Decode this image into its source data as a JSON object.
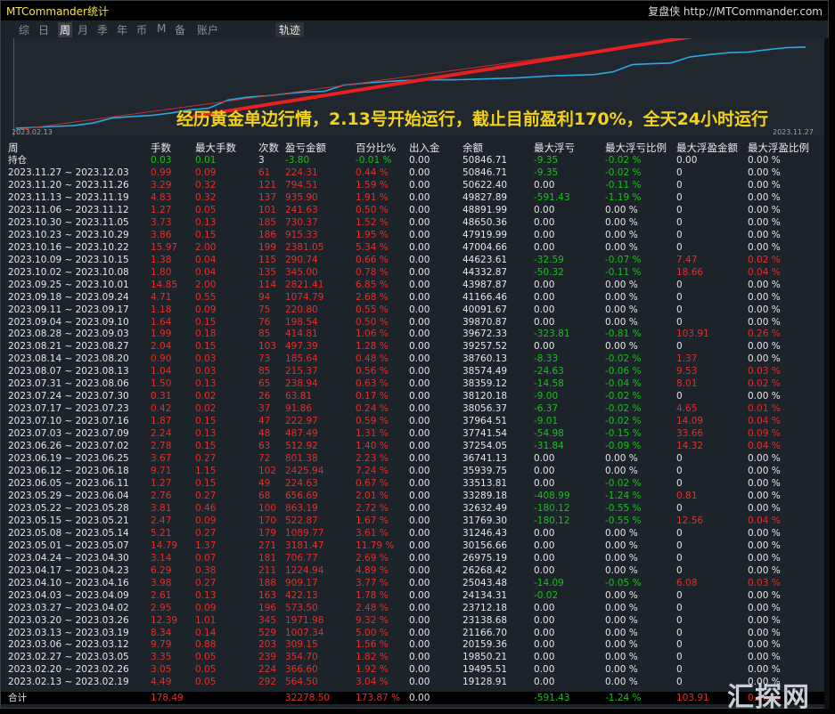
{
  "window": {
    "title": "MTCommander统计",
    "brand": "复盘侠",
    "url": "http://MTCommander.com"
  },
  "tabs": [
    {
      "label": "综",
      "active": false
    },
    {
      "label": "日",
      "active": false
    },
    {
      "label": "周",
      "active": true
    },
    {
      "label": "月",
      "active": false
    },
    {
      "label": "季",
      "active": false
    },
    {
      "label": "年",
      "active": false
    },
    {
      "label": "币",
      "active": false
    },
    {
      "label": "M",
      "active": false
    },
    {
      "label": "备",
      "active": false
    },
    {
      "label": "账户",
      "active": false
    },
    {
      "label": "轨迹",
      "active": false
    }
  ],
  "chart": {
    "annotation": "经历黄金单边行情，2.13号开始运行，截止目前盈利170%，全天24小时运行",
    "x_start": "2023.02.13",
    "x_end": "2023.11.27",
    "colors": {
      "equity": "#2aa8e0",
      "arrow": "#e82020",
      "trend": "#c23030"
    }
  },
  "columns": [
    "周",
    "手数",
    "最大手数",
    "次数",
    "盈亏金额",
    "百分比%",
    "出入金",
    "余额",
    "最大浮亏",
    "最大浮亏比例",
    "最大浮盈金额",
    "最大浮盈比例"
  ],
  "holding": [
    "持仓",
    "0.03",
    "0.01",
    "3",
    "-3.80",
    "-0.01 %",
    "0.00",
    "50846.71",
    "-9.35",
    "-0.02 %",
    "0.00",
    "0.00 %"
  ],
  "rows": [
    [
      "2023.11.27 ~ 2023.12.03",
      "0.99",
      "0.09",
      "61",
      "224.31",
      "0.44 %",
      "0.00",
      "50846.71",
      "-9.35",
      "-0.02 %",
      "0",
      "0.00 %"
    ],
    [
      "2023.11.20 ~ 2023.11.26",
      "3.29",
      "0.32",
      "121",
      "794.51",
      "1.59 %",
      "0.00",
      "50622.40",
      "0.00",
      "-0.11 %",
      "0",
      "0.00 %"
    ],
    [
      "2023.11.13 ~ 2023.11.19",
      "4.83",
      "0.32",
      "137",
      "935.90",
      "1.91 %",
      "0.00",
      "49827.89",
      "-591.43",
      "-1.19 %",
      "0",
      "0.00 %"
    ],
    [
      "2023.11.06 ~ 2023.11.12",
      "1.27",
      "0.05",
      "101",
      "241.63",
      "0.50 %",
      "0.00",
      "48891.99",
      "0.00",
      "0.00 %",
      "0",
      "0.00 %"
    ],
    [
      "2023.10.30 ~ 2023.11.05",
      "3.73",
      "0.13",
      "185",
      "730.37",
      "1.52 %",
      "0.00",
      "48650.36",
      "0.00",
      "0.00 %",
      "0",
      "0.00 %"
    ],
    [
      "2023.10.23 ~ 2023.10.29",
      "3.86",
      "0.15",
      "186",
      "915.33",
      "1.95 %",
      "0.00",
      "47919.99",
      "0.00",
      "0.00 %",
      "0",
      "0.00 %"
    ],
    [
      "2023.10.16 ~ 2023.10.22",
      "15.97",
      "2.00",
      "199",
      "2381.05",
      "5.34 %",
      "0.00",
      "47004.66",
      "0.00",
      "0.00 %",
      "0",
      "0.00 %"
    ],
    [
      "2023.10.09 ~ 2023.10.15",
      "1.38",
      "0.04",
      "115",
      "290.74",
      "0.66 %",
      "0.00",
      "44623.61",
      "-32.59",
      "-0.07 %",
      "7.47",
      "0.02 %"
    ],
    [
      "2023.10.02 ~ 2023.10.08",
      "1.80",
      "0.04",
      "135",
      "345.00",
      "0.78 %",
      "0.00",
      "44332.87",
      "-50.32",
      "-0.11 %",
      "18.66",
      "0.04 %"
    ],
    [
      "2023.09.25 ~ 2023.10.01",
      "14.85",
      "2.00",
      "114",
      "2821.41",
      "6.85 %",
      "0.00",
      "43987.87",
      "0.00",
      "0.00 %",
      "0",
      "0.00 %"
    ],
    [
      "2023.09.18 ~ 2023.09.24",
      "4.71",
      "0.55",
      "94",
      "1074.79",
      "2.68 %",
      "0.00",
      "41166.46",
      "0.00",
      "0.00 %",
      "0",
      "0.00 %"
    ],
    [
      "2023.09.11 ~ 2023.09.17",
      "1.18",
      "0.09",
      "75",
      "220.80",
      "0.55 %",
      "0.00",
      "40091.67",
      "0.00",
      "0.00 %",
      "0",
      "0.00 %"
    ],
    [
      "2023.09.04 ~ 2023.09.10",
      "1.64",
      "0.15",
      "76",
      "198.54",
      "0.50 %",
      "0.00",
      "39870.87",
      "0.00",
      "0.00 %",
      "0",
      "0.00 %"
    ],
    [
      "2023.08.28 ~ 2023.09.03",
      "1.99",
      "0.18",
      "85",
      "414.81",
      "1.06 %",
      "0.00",
      "39672.33",
      "-323.81",
      "-0.81 %",
      "103.91",
      "0.26 %"
    ],
    [
      "2023.08.21 ~ 2023.08.27",
      "2.04",
      "0.15",
      "103",
      "497.39",
      "1.28 %",
      "0.00",
      "39257.52",
      "0.00",
      "0.00 %",
      "0",
      "0.00 %"
    ],
    [
      "2023.08.14 ~ 2023.08.20",
      "0.90",
      "0.03",
      "73",
      "185.64",
      "0.48 %",
      "0.00",
      "38760.13",
      "-8.33",
      "-0.02 %",
      "1.37",
      "0.00 %"
    ],
    [
      "2023.08.07 ~ 2023.08.13",
      "1.04",
      "0.03",
      "85",
      "215.37",
      "0.56 %",
      "0.00",
      "38574.49",
      "-24.63",
      "-0.06 %",
      "9.53",
      "0.03 %"
    ],
    [
      "2023.07.31 ~ 2023.08.06",
      "1.50",
      "0.13",
      "65",
      "238.94",
      "0.63 %",
      "0.00",
      "38359.12",
      "-14.58",
      "-0.04 %",
      "8.01",
      "0.02 %"
    ],
    [
      "2023.07.24 ~ 2023.07.30",
      "0.31",
      "0.02",
      "26",
      "63.81",
      "0.17 %",
      "0.00",
      "38120.18",
      "-9.00",
      "-0.02 %",
      "0",
      "0.00 %"
    ],
    [
      "2023.07.17 ~ 2023.07.23",
      "0.42",
      "0.02",
      "37",
      "91.86",
      "0.24 %",
      "0.00",
      "38056.37",
      "-6.37",
      "-0.02 %",
      "4.65",
      "0.01 %"
    ],
    [
      "2023.07.10 ~ 2023.07.16",
      "1.87",
      "0.15",
      "47",
      "222.97",
      "0.59 %",
      "0.00",
      "37964.51",
      "-9.01",
      "-0.02 %",
      "14.09",
      "0.04 %"
    ],
    [
      "2023.07.03 ~ 2023.07.09",
      "2.24",
      "0.13",
      "48",
      "487.49",
      "1.31 %",
      "0.00",
      "37741.54",
      "-54.98",
      "-0.15 %",
      "33.66",
      "0.09 %"
    ],
    [
      "2023.06.26 ~ 2023.07.02",
      "2.78",
      "0.15",
      "63",
      "512.92",
      "1.40 %",
      "0.00",
      "37254.05",
      "-31.84",
      "-0.09 %",
      "14.32",
      "0.04 %"
    ],
    [
      "2023.06.19 ~ 2023.06.25",
      "3.67",
      "0.27",
      "72",
      "801.38",
      "2.23 %",
      "0.00",
      "36741.13",
      "0.00",
      "0.00 %",
      "0",
      "0.00 %"
    ],
    [
      "2023.06.12 ~ 2023.06.18",
      "9.71",
      "1.15",
      "102",
      "2425.94",
      "7.24 %",
      "0.00",
      "35939.75",
      "0.00",
      "0.00 %",
      "0",
      "0.00 %"
    ],
    [
      "2023.06.05 ~ 2023.06.11",
      "1.27",
      "0.15",
      "49",
      "224.63",
      "0.67 %",
      "0.00",
      "33513.81",
      "0.00",
      "-0.02 %",
      "0",
      "0.00 %"
    ],
    [
      "2023.05.29 ~ 2023.06.04",
      "2.76",
      "0.27",
      "68",
      "656.69",
      "2.01 %",
      "0.00",
      "33289.18",
      "-408.99",
      "-1.24 %",
      "0.81",
      "0.00 %"
    ],
    [
      "2023.05.22 ~ 2023.05.28",
      "3.81",
      "0.46",
      "100",
      "863.19",
      "2.72 %",
      "0.00",
      "32632.49",
      "-180.12",
      "-0.55 %",
      "0",
      "0.00 %"
    ],
    [
      "2023.05.15 ~ 2023.05.21",
      "2.47",
      "0.09",
      "170",
      "522.87",
      "1.67 %",
      "0.00",
      "31769.30",
      "-180.12",
      "-0.55 %",
      "12.56",
      "0.04 %"
    ],
    [
      "2023.05.08 ~ 2023.05.14",
      "5.21",
      "0.27",
      "179",
      "1089.77",
      "3.61 %",
      "0.00",
      "31246.43",
      "0.00",
      "0.00 %",
      "0",
      "0.00 %"
    ],
    [
      "2023.05.01 ~ 2023.05.07",
      "14.79",
      "1.37",
      "271",
      "3181.47",
      "11.79 %",
      "0.00",
      "30156.66",
      "0.00",
      "0.00 %",
      "0",
      "0.00 %"
    ],
    [
      "2023.04.24 ~ 2023.04.30",
      "3.14",
      "0.07",
      "181",
      "706.77",
      "2.69 %",
      "0.00",
      "26975.19",
      "0.00",
      "0.00 %",
      "0",
      "0.00 %"
    ],
    [
      "2023.04.17 ~ 2023.04.23",
      "6.29",
      "0.38",
      "211",
      "1224.94",
      "4.89 %",
      "0.00",
      "26268.42",
      "0.00",
      "0.00 %",
      "0",
      "0.00 %"
    ],
    [
      "2023.04.10 ~ 2023.04.16",
      "3.98",
      "0.27",
      "188",
      "909.17",
      "3.77 %",
      "0.00",
      "25043.48",
      "-14.09",
      "-0.05 %",
      "6.08",
      "0.03 %"
    ],
    [
      "2023.04.03 ~ 2023.04.09",
      "2.61",
      "0.13",
      "163",
      "422.13",
      "1.78 %",
      "0.00",
      "24134.31",
      "-0.02",
      "0.00 %",
      "0",
      "0.00 %"
    ],
    [
      "2023.03.27 ~ 2023.04.02",
      "2.95",
      "0.09",
      "196",
      "573.50",
      "2.48 %",
      "0.00",
      "23712.18",
      "0.00",
      "0.00 %",
      "0",
      "0.00 %"
    ],
    [
      "2023.03.20 ~ 2023.03.26",
      "12.39",
      "1.01",
      "345",
      "1971.98",
      "9.32 %",
      "0.00",
      "23138.68",
      "0.00",
      "0.00 %",
      "0",
      "0.00 %"
    ],
    [
      "2023.03.13 ~ 2023.03.19",
      "8.34",
      "0.14",
      "529",
      "1007.34",
      "5.00 %",
      "0.00",
      "21166.70",
      "0.00",
      "0.00 %",
      "0",
      "0.00 %"
    ],
    [
      "2023.03.06 ~ 2023.03.12",
      "9.79",
      "0.88",
      "203",
      "309.15",
      "1.56 %",
      "0.00",
      "20159.36",
      "0.00",
      "0.00 %",
      "0",
      "0.00 %"
    ],
    [
      "2023.02.27 ~ 2023.03.05",
      "3.35",
      "0.05",
      "239",
      "354.70",
      "1.82 %",
      "0.00",
      "19850.21",
      "0.00",
      "0.00 %",
      "0",
      "0.00 %"
    ],
    [
      "2023.02.20 ~ 2023.02.26",
      "3.05",
      "0.05",
      "224",
      "366.60",
      "1.92 %",
      "0.00",
      "19495.51",
      "0.00",
      "0.00 %",
      "0",
      "0.00 %"
    ],
    [
      "2023.02.13 ~ 2023.02.19",
      "4.49",
      "0.05",
      "292",
      "564.50",
      "3.04 %",
      "0.00",
      "19128.91",
      "0.00",
      "0.00 %",
      "0",
      "0.00 %"
    ]
  ],
  "total": [
    "合计",
    "178.49",
    "",
    "",
    "32278.50",
    "173.87 %",
    "0.00",
    "",
    "-591.43",
    "-1.24 %",
    "103.91",
    "0.26 %"
  ],
  "watermark": "汇探网"
}
